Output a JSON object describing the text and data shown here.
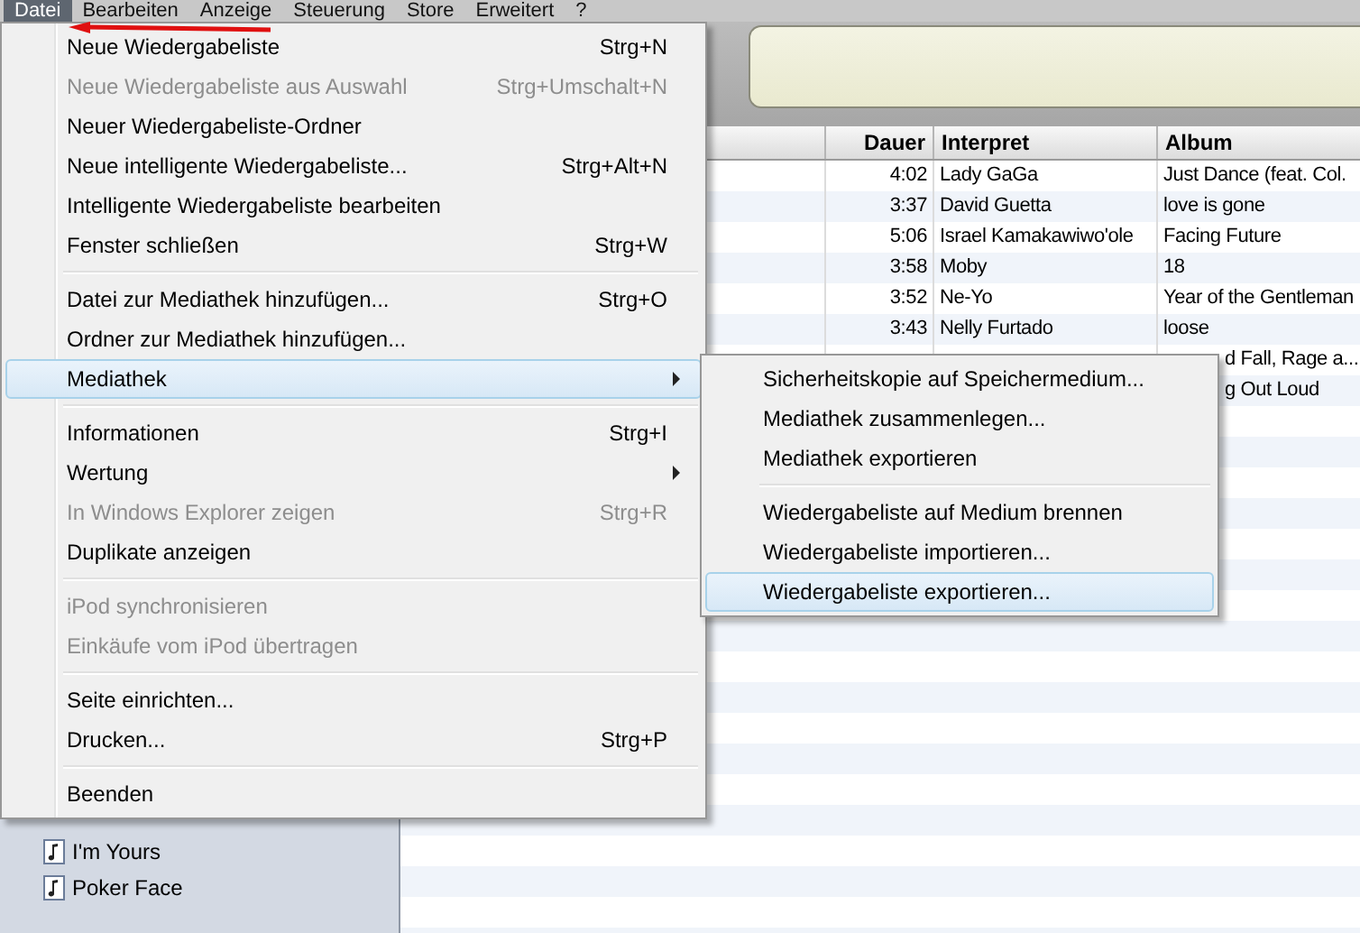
{
  "menubar": [
    {
      "label": "Datei",
      "selected": true
    },
    {
      "label": "Bearbeiten",
      "selected": false
    },
    {
      "label": "Anzeige",
      "selected": false
    },
    {
      "label": "Steuerung",
      "selected": false
    },
    {
      "label": "Store",
      "selected": false
    },
    {
      "label": "Erweitert",
      "selected": false
    },
    {
      "label": "?",
      "selected": false
    }
  ],
  "table": {
    "columns": [
      "Dauer",
      "Interpret",
      "Album"
    ],
    "rows": [
      {
        "dauer": "4:02",
        "interpret": "Lady GaGa",
        "album": "Just Dance (feat. Col."
      },
      {
        "dauer": "3:37",
        "interpret": "David Guetta",
        "album": "love is gone"
      },
      {
        "dauer": "5:06",
        "interpret": "Israel Kamakawiwo'ole",
        "album": "Facing Future"
      },
      {
        "dauer": "3:58",
        "interpret": "Moby",
        "album": "18"
      },
      {
        "dauer": "3:52",
        "interpret": "Ne-Yo",
        "album": "Year of the Gentleman"
      },
      {
        "dauer": "3:43",
        "interpret": "Nelly Furtado",
        "album": "loose"
      },
      {
        "album": "d Fall, Rage a..."
      },
      {
        "album": "g Out Loud"
      }
    ]
  },
  "sidebar": {
    "items": [
      "I'm Yours",
      "Poker Face"
    ]
  },
  "menu": {
    "groups": [
      [
        {
          "label": "Neue Wiedergabeliste",
          "shortcut": "Strg+N",
          "disabled": false,
          "selected": false,
          "submenu": false
        },
        {
          "label": "Neue Wiedergabeliste aus Auswahl",
          "shortcut": "Strg+Umschalt+N",
          "disabled": true,
          "selected": false,
          "submenu": false
        },
        {
          "label": "Neuer Wiedergabeliste-Ordner",
          "disabled": false,
          "selected": false,
          "submenu": false
        },
        {
          "label": "Neue intelligente Wiedergabeliste...",
          "shortcut": "Strg+Alt+N",
          "disabled": false,
          "selected": false,
          "submenu": false
        },
        {
          "label": "Intelligente Wiedergabeliste bearbeiten",
          "disabled": false,
          "selected": false,
          "submenu": false
        },
        {
          "label": "Fenster schließen",
          "shortcut": "Strg+W",
          "disabled": false,
          "selected": false,
          "submenu": false
        }
      ],
      [
        {
          "label": "Datei zur Mediathek hinzufügen...",
          "shortcut": "Strg+O",
          "disabled": false,
          "selected": false,
          "submenu": false
        },
        {
          "label": "Ordner zur Mediathek hinzufügen...",
          "disabled": false,
          "selected": false,
          "submenu": false
        },
        {
          "label": "Mediathek",
          "disabled": false,
          "selected": true,
          "submenu": true
        }
      ],
      [
        {
          "label": "Informationen",
          "shortcut": "Strg+I",
          "disabled": false,
          "selected": false,
          "submenu": false
        },
        {
          "label": "Wertung",
          "disabled": false,
          "selected": false,
          "submenu": true
        },
        {
          "label": "In Windows Explorer zeigen",
          "shortcut": "Strg+R",
          "disabled": true,
          "selected": false,
          "submenu": false
        },
        {
          "label": "Duplikate anzeigen",
          "disabled": false,
          "selected": false,
          "submenu": false
        }
      ],
      [
        {
          "label": "iPod synchronisieren",
          "disabled": true,
          "selected": false,
          "submenu": false
        },
        {
          "label": "Einkäufe vom iPod übertragen",
          "disabled": true,
          "selected": false,
          "submenu": false
        }
      ],
      [
        {
          "label": "Seite einrichten...",
          "disabled": false,
          "selected": false,
          "submenu": false
        },
        {
          "label": "Drucken...",
          "shortcut": "Strg+P",
          "disabled": false,
          "selected": false,
          "submenu": false
        }
      ],
      [
        {
          "label": "Beenden",
          "disabled": false,
          "selected": false,
          "submenu": false
        }
      ]
    ]
  },
  "submenu": {
    "groups": [
      [
        {
          "label": "Sicherheitskopie auf Speichermedium...",
          "selected": false
        },
        {
          "label": "Mediathek zusammenlegen...",
          "selected": false
        },
        {
          "label": "Mediathek exportieren",
          "selected": false
        }
      ],
      [
        {
          "label": "Wiedergabeliste auf Medium brennen",
          "selected": false
        },
        {
          "label": "Wiedergabeliste importieren...",
          "selected": false
        },
        {
          "label": "Wiedergabeliste exportieren...",
          "selected": true
        }
      ]
    ]
  }
}
